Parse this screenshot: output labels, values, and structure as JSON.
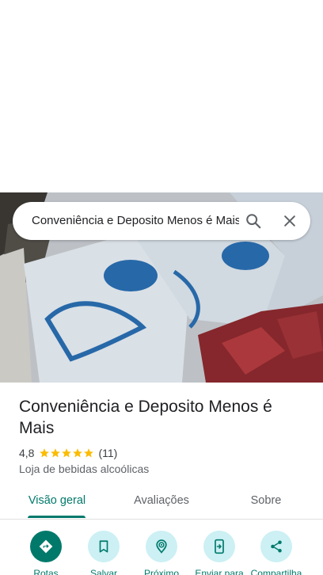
{
  "search": {
    "query": "Conveniência e Deposito Menos é Mais"
  },
  "place": {
    "title": "Conveniência e Deposito Menos é Mais",
    "rating": "4,8",
    "review_count": "(11)",
    "stars": 5,
    "category": "Loja de bebidas alcoólicas"
  },
  "tabs": [
    {
      "label": "Visão geral",
      "active": true
    },
    {
      "label": "Avaliações",
      "active": false
    },
    {
      "label": "Sobre",
      "active": false
    }
  ],
  "actions": [
    {
      "label": "Rotas",
      "icon": "directions-icon"
    },
    {
      "label": "Salvar",
      "icon": "bookmark-icon"
    },
    {
      "label": "Próximo",
      "icon": "nearby-icon"
    },
    {
      "label": "Enviar para",
      "icon": "send-to-phone-icon"
    },
    {
      "label": "Compartilha",
      "icon": "share-icon"
    }
  ],
  "colors": {
    "accent": "#00796b",
    "action_bg": "#ccf0f4",
    "star": "#fbbc04"
  }
}
